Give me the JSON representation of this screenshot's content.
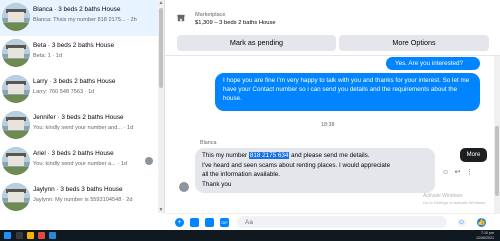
{
  "conversations": [
    {
      "title": "Blanca · 3 beds 2 baths House",
      "preview": "Blanca: Thsis my number 818 2175...",
      "time": "2h",
      "active": true
    },
    {
      "title": "Beta · 3 beds 2 baths House",
      "preview": "Beta: 1",
      "time": "1d",
      "active": false
    },
    {
      "title": "Larry · 3 beds 2 baths House",
      "preview": "Larry: 760 548 7563",
      "time": "1d",
      "active": false
    },
    {
      "title": "Jennifer · 3 beds 2 baths House",
      "preview": "You: kindly send your number and...",
      "time": "1d",
      "active": false
    },
    {
      "title": "Ariel · 3 beds 2 baths House",
      "preview": "You: kindly send your number a...",
      "time": "1d",
      "active": false
    },
    {
      "title": "Jaylynn · 3 beds 3 baths House",
      "preview": "Jaylynn: My number is 5593104548",
      "time": "2d",
      "active": false
    }
  ],
  "header": {
    "source_label": "Marketplace",
    "listing": "$1,309 – 3 beds 2 baths House",
    "mark_pending_label": "Mark as pending",
    "more_options_label": "More Options"
  },
  "messages": {
    "outgoing_1": "Yes. Are you interested?",
    "outgoing_2": "I hope you are fine I'm very happy to talk with you and thanks for your interest. So let me have your Contact number so i can send you details and the requirements about the house.",
    "timestamp": "18:38",
    "incoming_sender": "Blanca",
    "incoming_line1_prefix": "This my number ",
    "incoming_line1_highlight": "818 2175 634",
    "incoming_line1_suffix": " and please send me details.",
    "incoming_line2": "I've heard and seen scams about renting places. I would appreciate",
    "incoming_line3": "all the information available.",
    "incoming_line4": "Thank you"
  },
  "tooltip": {
    "more": "More"
  },
  "composer": {
    "placeholder": "Aa"
  },
  "watermark": {
    "line1": "Activate Windows",
    "line2": "Go to Settings to activate Windows."
  },
  "taskbar": {
    "time": "7:10 pm",
    "date": "12/06/2021"
  },
  "colors": {
    "accent": "#0084ff",
    "incoming_bubble": "#e4e6eb",
    "active_row": "#e7f3ff"
  }
}
